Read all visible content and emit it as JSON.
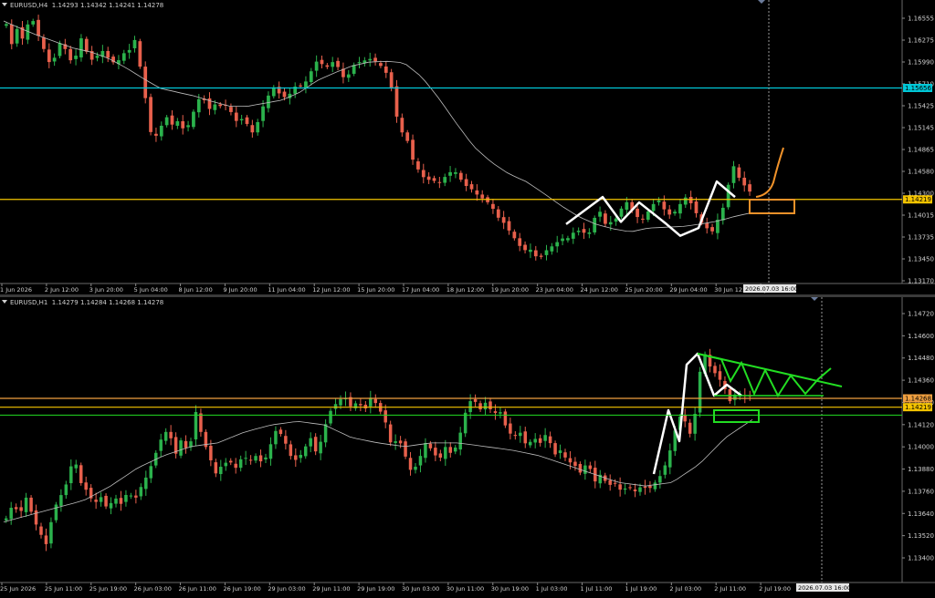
{
  "chart_data": [
    {
      "type": "candlestick",
      "symbol_label": "EURUSD,H4",
      "ohlc_label": "1.14293 1.14342 1.14241 1.14278",
      "y_ticks": [
        "1.16555",
        "1.16275",
        "1.15990",
        "1.15710",
        "1.15425",
        "1.15145",
        "1.14865",
        "1.14580",
        "1.14300",
        "1.14015",
        "1.13735",
        "1.13450",
        "1.13170"
      ],
      "ylim": [
        1.1317,
        1.16555
      ],
      "x_ticks": [
        "1 Jun 2026",
        "2 Jun 12:00",
        "3 Jun 20:00",
        "5 Jun 04:00",
        "8 Jun 12:00",
        "9 Jun 20:00",
        "11 Jun 04:00",
        "12 Jun 12:00",
        "15 Jun 20:00",
        "17 Jun 04:00",
        "18 Jun 12:00",
        "19 Jun 20:00",
        "23 Jun 04:00",
        "24 Jun 12:00",
        "25 Jun 20:00",
        "29 Jun 04:00",
        "30 Jun 12:00",
        "1 Jul 20:00"
      ],
      "cursor_time": "2026.07.03 16:00",
      "price_tags": [
        {
          "value": 1.15656,
          "label": "1.15656",
          "color": "#00c8d8"
        },
        {
          "value": 1.14219,
          "label": "1.14219",
          "color": "#f5c400"
        }
      ],
      "close_path": [
        1.1648,
        1.1622,
        1.1642,
        1.1629,
        1.1648,
        1.1652,
        1.1632,
        1.1615,
        1.1598,
        1.1605,
        1.1625,
        1.1615,
        1.16,
        1.1608,
        1.1632,
        1.161,
        1.1601,
        1.1608,
        1.1614,
        1.1603,
        1.1598,
        1.1602,
        1.1612,
        1.1615,
        1.163,
        1.1585,
        1.1545,
        1.15,
        1.1505,
        1.152,
        1.153,
        1.1515,
        1.1525,
        1.151,
        1.152,
        1.154,
        1.1555,
        1.1548,
        1.1535,
        1.1548,
        1.154,
        1.1545,
        1.153,
        1.152,
        1.1528,
        1.1515,
        1.1505,
        1.153,
        1.1548,
        1.156,
        1.157,
        1.1552,
        1.1555,
        1.156,
        1.1572,
        1.1565,
        1.158,
        1.1592,
        1.1605,
        1.159,
        1.1595,
        1.1602,
        1.1585,
        1.1575,
        1.159,
        1.16,
        1.1598,
        1.1604,
        1.1602,
        1.1598,
        1.159,
        1.158,
        1.155,
        1.1505,
        1.1512,
        1.148,
        1.1465,
        1.1455,
        1.1445,
        1.145,
        1.144,
        1.1448,
        1.1455,
        1.146,
        1.1452,
        1.144,
        1.1438,
        1.143,
        1.1425,
        1.142,
        1.1415,
        1.14,
        1.1395,
        1.1385,
        1.1375,
        1.1365,
        1.1355,
        1.136,
        1.135,
        1.1345,
        1.1355,
        1.136,
        1.1365,
        1.1372,
        1.137,
        1.1378,
        1.1382,
        1.138,
        1.1375,
        1.1395,
        1.141,
        1.139,
        1.1392,
        1.1395,
        1.1408,
        1.142,
        1.141,
        1.14,
        1.1395,
        1.1405,
        1.1415,
        1.1422,
        1.141,
        1.1402,
        1.1405,
        1.1415,
        1.1425,
        1.1418,
        1.1405,
        1.1392,
        1.1385,
        1.138,
        1.1395,
        1.141,
        1.144,
        1.1465,
        1.145,
        1.144,
        1.1432
      ],
      "ma_path": [
        1.1652,
        1.1642,
        1.1633,
        1.1625,
        1.1617,
        1.1612,
        1.1604,
        1.1592,
        1.1578,
        1.1565,
        1.156,
        1.1555,
        1.1548,
        1.1542,
        1.1542,
        1.1546,
        1.155,
        1.156,
        1.1575,
        1.1585,
        1.1594,
        1.1599,
        1.16,
        1.1598,
        1.158,
        1.1552,
        1.152,
        1.149,
        1.147,
        1.1455,
        1.1445,
        1.143,
        1.1414,
        1.14,
        1.139,
        1.1384,
        1.138,
        1.1385,
        1.1386,
        1.1387,
        1.139,
        1.1394,
        1.14,
        1.1405
      ],
      "annotations": [
        {
          "type": "white-zigzag",
          "points": [
            [
              0.62,
              1.139
            ],
            [
              0.66,
              1.1425
            ],
            [
              0.68,
              1.1393
            ],
            [
              0.7,
              1.1418
            ],
            [
              0.73,
              1.139
            ],
            [
              0.745,
              1.1375
            ],
            [
              0.765,
              1.1385
            ],
            [
              0.785,
              1.1445
            ],
            [
              0.805,
              1.1425
            ]
          ]
        },
        {
          "type": "orange-arrow"
        },
        {
          "type": "orange-box"
        }
      ]
    },
    {
      "type": "candlestick",
      "symbol_label": "EURUSD,H1",
      "ohlc_label": "1.14279 1.14284 1.14268 1.14278",
      "y_ticks": [
        "1.14720",
        "1.14600",
        "1.14480",
        "1.14360",
        "1.14240",
        "1.14120",
        "1.14000",
        "1.13880",
        "1.13760",
        "1.13640",
        "1.13520",
        "1.13400"
      ],
      "ylim": [
        1.1338,
        1.1474
      ],
      "x_ticks": [
        "25 Jun 2026",
        "25 Jun 11:00",
        "25 Jun 19:00",
        "26 Jun 03:00",
        "26 Jun 11:00",
        "26 Jun 19:00",
        "29 Jun 03:00",
        "29 Jun 11:00",
        "29 Jun 19:00",
        "30 Jun 03:00",
        "30 Jun 11:00",
        "30 Jun 19:00",
        "1 Jul 03:00",
        "1 Jul 11:00",
        "1 Jul 19:00",
        "2 Jul 03:00",
        "2 Jul 11:00",
        "2 Jul 19:00"
      ],
      "cursor_time": "2026.07.03 16:00",
      "price_tags": [
        {
          "value": 1.14268,
          "label": "1.14268",
          "color": "#f0a040"
        },
        {
          "value": 1.14219,
          "label": "1.14219",
          "color": "#f5c400"
        }
      ],
      "close_path": [
        1.136,
        1.1368,
        1.1362,
        1.1372,
        1.136,
        1.1352,
        1.1345,
        1.1365,
        1.1372,
        1.138,
        1.1395,
        1.138,
        1.1375,
        1.1368,
        1.1372,
        1.1365,
        1.1372,
        1.1368,
        1.1375,
        1.137,
        1.1378,
        1.1385,
        1.1395,
        1.1405,
        1.141,
        1.1395,
        1.1405,
        1.1395,
        1.142,
        1.1405,
        1.1395,
        1.1385,
        1.139,
        1.1392,
        1.1388,
        1.1395,
        1.1392,
        1.1395,
        1.139,
        1.14,
        1.141,
        1.1405,
        1.1395,
        1.1392,
        1.1398,
        1.1405,
        1.1395,
        1.141,
        1.142,
        1.1425,
        1.1428,
        1.1422,
        1.1425,
        1.142,
        1.1428,
        1.1422,
        1.1415,
        1.14,
        1.1405,
        1.1395,
        1.1385,
        1.1392,
        1.1402,
        1.1398,
        1.1392,
        1.14,
        1.1395,
        1.1405,
        1.142,
        1.1428,
        1.142,
        1.1425,
        1.1418,
        1.142,
        1.141,
        1.1405,
        1.1408,
        1.14,
        1.1405,
        1.1402,
        1.1408,
        1.1395,
        1.1398,
        1.1392,
        1.139,
        1.1385,
        1.1392,
        1.138,
        1.1385,
        1.1378,
        1.138,
        1.1375,
        1.1378,
        1.1375,
        1.1378,
        1.1376,
        1.138,
        1.1385,
        1.1395,
        1.141,
        1.142,
        1.1405,
        1.142,
        1.1455,
        1.1445,
        1.144,
        1.1435,
        1.1425,
        1.143,
        1.1428,
        1.1428
      ],
      "ma_path": [
        1.1358,
        1.1362,
        1.1366,
        1.137,
        1.1378,
        1.1388,
        1.1395,
        1.14,
        1.1402,
        1.1408,
        1.1412,
        1.1414,
        1.1412,
        1.1405,
        1.1402,
        1.14,
        1.1402,
        1.1402,
        1.14,
        1.1398,
        1.1395,
        1.139,
        1.1385,
        1.138,
        1.1378,
        1.138,
        1.139,
        1.1405,
        1.1415
      ],
      "annotations": [
        {
          "type": "white-zigzag"
        },
        {
          "type": "green-triangle"
        },
        {
          "type": "green-box"
        }
      ]
    }
  ]
}
